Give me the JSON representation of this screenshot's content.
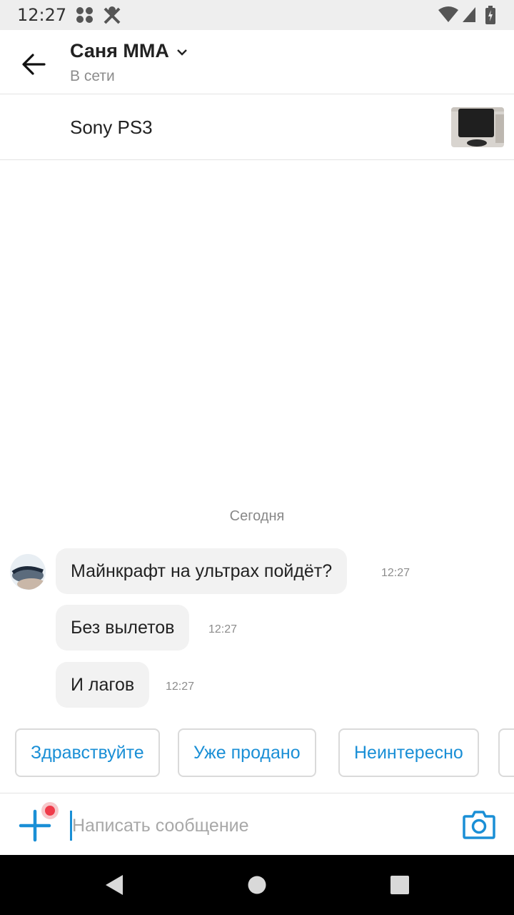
{
  "status_bar": {
    "time": "12:27",
    "icons": [
      "notification-dots-icon",
      "tools-icon",
      "wifi-icon",
      "signal-icon",
      "battery-icon"
    ]
  },
  "header": {
    "title": "Саня ММА",
    "subtitle": "В сети"
  },
  "listing": {
    "title": "Sony PS3"
  },
  "chat": {
    "date_separator": "Сегодня",
    "messages": [
      {
        "text": "Майнкрафт на ультрах пойдёт?",
        "time": "12:27"
      },
      {
        "text": "Без вылетов",
        "time": "12:27"
      },
      {
        "text": "И лагов",
        "time": "12:27"
      }
    ]
  },
  "quick_replies": [
    "Здравствуйте",
    "Уже продано",
    "Неинтересно"
  ],
  "composer": {
    "placeholder": "Написать сообщение"
  },
  "colors": {
    "accent": "#1a8fd6",
    "badge": "#ef3b4a",
    "bubble": "#f2f2f2"
  }
}
